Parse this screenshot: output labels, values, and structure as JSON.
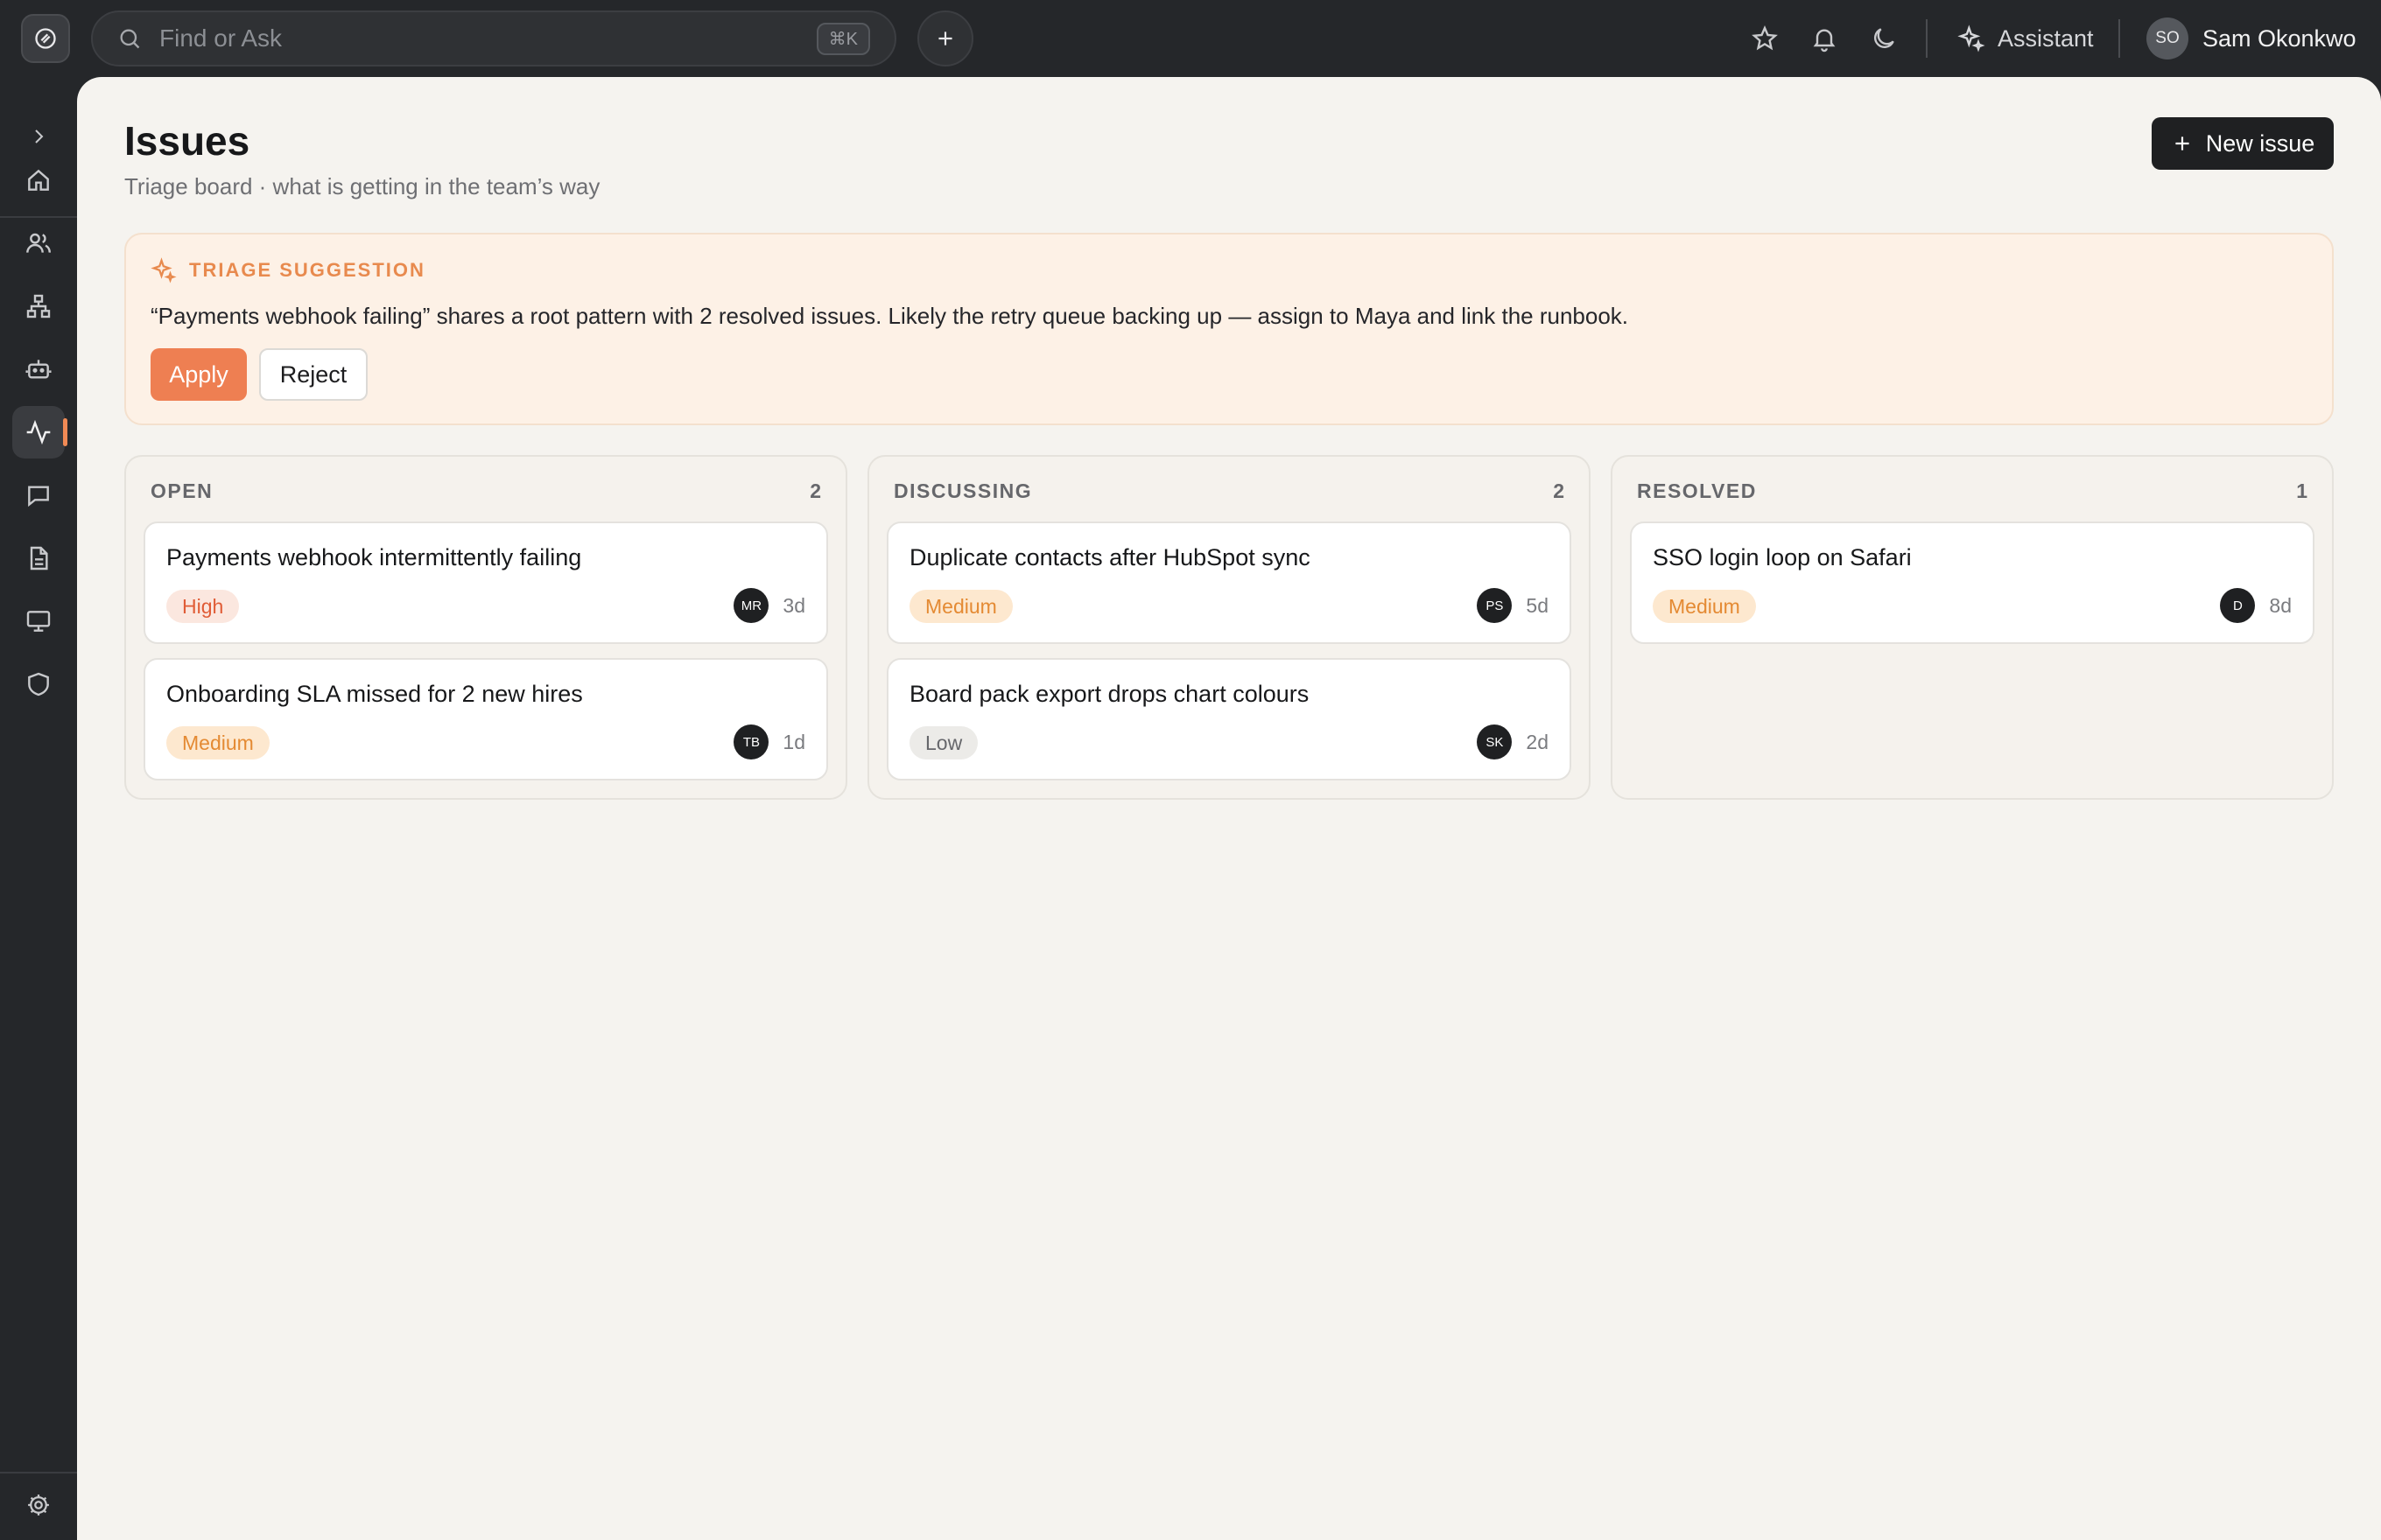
{
  "topbar": {
    "search_placeholder": "Find or Ask",
    "search_shortcut": "⌘K",
    "assistant_label": "Assistant",
    "user_initials": "SO",
    "user_name": "Sam Okonkwo"
  },
  "sidebar": {
    "items": [
      {
        "icon": "home-icon"
      },
      {
        "icon": "users-icon"
      },
      {
        "icon": "org-chart-icon"
      },
      {
        "icon": "bot-icon"
      },
      {
        "icon": "activity-icon",
        "active": true
      },
      {
        "icon": "chat-icon"
      },
      {
        "icon": "document-icon"
      },
      {
        "icon": "monitor-icon"
      },
      {
        "icon": "shield-icon"
      }
    ]
  },
  "page": {
    "title": "Issues",
    "subtitle": "Triage board · what is getting in the team’s way",
    "new_issue_label": "New issue"
  },
  "suggestion": {
    "label": "TRIAGE SUGGESTION",
    "text": "“Payments webhook failing” shares a root pattern with 2 resolved issues. Likely the retry queue backing up — assign to Maya and link the runbook.",
    "apply_label": "Apply",
    "reject_label": "Reject"
  },
  "columns": [
    {
      "title": "OPEN",
      "count": "2",
      "cards": [
        {
          "title": "Payments webhook intermittently failing",
          "priority": "High",
          "assignee": "MR",
          "age": "3d"
        },
        {
          "title": "Onboarding SLA missed for 2 new hires",
          "priority": "Medium",
          "assignee": "TB",
          "age": "1d"
        }
      ]
    },
    {
      "title": "DISCUSSING",
      "count": "2",
      "cards": [
        {
          "title": "Duplicate contacts after HubSpot sync",
          "priority": "Medium",
          "assignee": "PS",
          "age": "5d"
        },
        {
          "title": "Board pack export drops chart colours",
          "priority": "Low",
          "assignee": "SK",
          "age": "2d"
        }
      ]
    },
    {
      "title": "RESOLVED",
      "count": "1",
      "cards": [
        {
          "title": "SSO login loop on Safari",
          "priority": "Medium",
          "assignee": "D",
          "age": "8d"
        }
      ]
    }
  ],
  "colors": {
    "accent": "#ee7f52",
    "chrome": "#25272a",
    "canvas": "#f5f3ef"
  }
}
